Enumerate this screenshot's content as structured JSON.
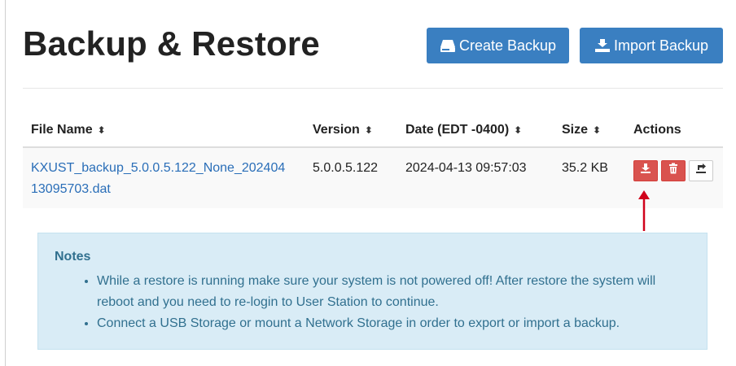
{
  "page": {
    "title": "Backup & Restore"
  },
  "toolbar": {
    "create_label": "Create Backup",
    "import_label": "Import Backup"
  },
  "table": {
    "headers": {
      "file_name": "File Name",
      "version": "Version",
      "date": "Date (EDT -0400)",
      "size": "Size",
      "actions": "Actions"
    },
    "sort_glyph": "⬍",
    "rows": [
      {
        "file_name": "KXUST_backup_5.0.0.5.122_None_20240413095703.dat",
        "version": "5.0.0.5.122",
        "date": "2024-04-13 09:57:03",
        "size": "35.2 KB",
        "actions": [
          "download-icon",
          "trash-icon",
          "export-icon"
        ]
      }
    ]
  },
  "notes": {
    "title": "Notes",
    "items": [
      "While a restore is running make sure your system is not powered off! After restore the system will reboot and you need to re-login to User Station to continue.",
      "Connect a USB Storage or mount a Network Storage in order to export or import a backup."
    ]
  },
  "colors": {
    "primary": "#3a7fc1",
    "danger": "#d9534f",
    "link": "#2a6eb8",
    "info_bg": "#d9ecf6",
    "info_text": "#31708f",
    "annotation_arrow": "#d0021b"
  }
}
